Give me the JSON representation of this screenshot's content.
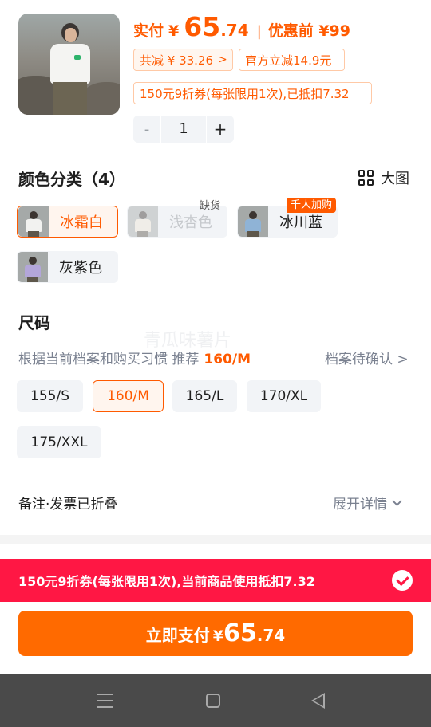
{
  "product": {
    "paid_label": "实付",
    "currency": "¥",
    "price_int": "65",
    "price_dec": ".74",
    "before_discount": "优惠前 ¥99",
    "total_discount": "共减 ¥ 33.26",
    "official_discount": "官方立减14.9元",
    "coupon_tag": "150元9折券(每张限用1次),已抵扣7.32",
    "quantity": "1",
    "minus": "-",
    "plus": "+"
  },
  "colors": {
    "title": "颜色分类（4）",
    "big_image_label": "大图",
    "items": [
      {
        "label": "冰霜白",
        "selected": true,
        "shirt_color": "#f2f2f0"
      },
      {
        "label": "浅杏色",
        "disabled": true,
        "badge": "缺货",
        "shirt_color": "#efe6d6"
      },
      {
        "label": "冰川蓝",
        "badge": "千人加购",
        "shirt_color": "#8fb3d6"
      },
      {
        "label": "灰紫色",
        "shirt_color": "#b3a6d9"
      }
    ]
  },
  "size": {
    "title": "尺码",
    "hint": "根据当前档案和购买习惯 推荐",
    "recommended": "160/M",
    "profile_link": "档案待确认",
    "options": [
      "155/S",
      "160/M",
      "165/L",
      "170/XL",
      "175/XXL"
    ],
    "selected": "160/M"
  },
  "remark": {
    "label": "备注·发票已折叠",
    "expand": "展开详情"
  },
  "coupon_bar": {
    "text": "150元9折券(每张限用1次),当前商品使用抵扣7.32"
  },
  "pay": {
    "label": "立即支付",
    "currency": "¥",
    "int": "65",
    "dec": ".74"
  },
  "watermark": "青瓜味薯片",
  "colors_theme": {
    "accent": "#ff5a00",
    "coupon_red": "#ff1744",
    "pay_orange": "#ff6a00"
  }
}
